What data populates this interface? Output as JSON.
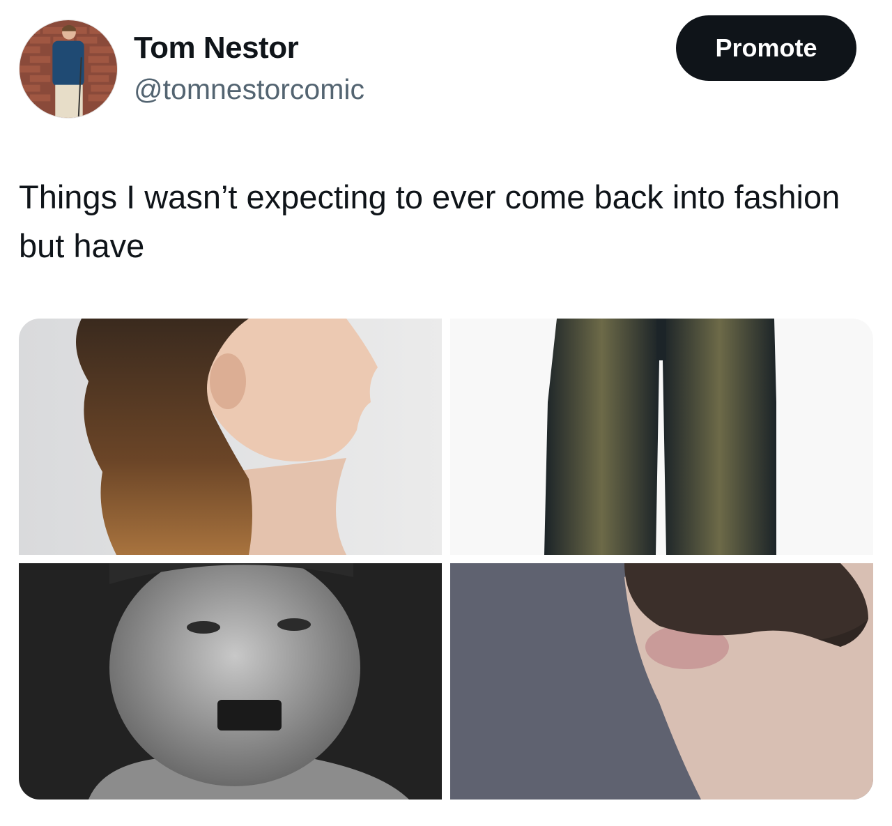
{
  "author": {
    "display_name": "Tom Nestor",
    "handle": "@tomnestorcomic"
  },
  "actions": {
    "promote_label": "Promote"
  },
  "tweet": {
    "text": "Things I wasn’t expecting to ever come back into fashion but have"
  },
  "media": [
    {
      "icon": "mullet-haircut-photo"
    },
    {
      "icon": "baggy-faded-jeans-photo"
    },
    {
      "icon": "toothbrush-mustache-photo"
    },
    {
      "icon": "handlebar-mustache-photo"
    }
  ],
  "colors": {
    "text_primary": "#0f1419",
    "text_secondary": "#536471",
    "button_bg": "#0f1419",
    "button_text": "#ffffff"
  }
}
